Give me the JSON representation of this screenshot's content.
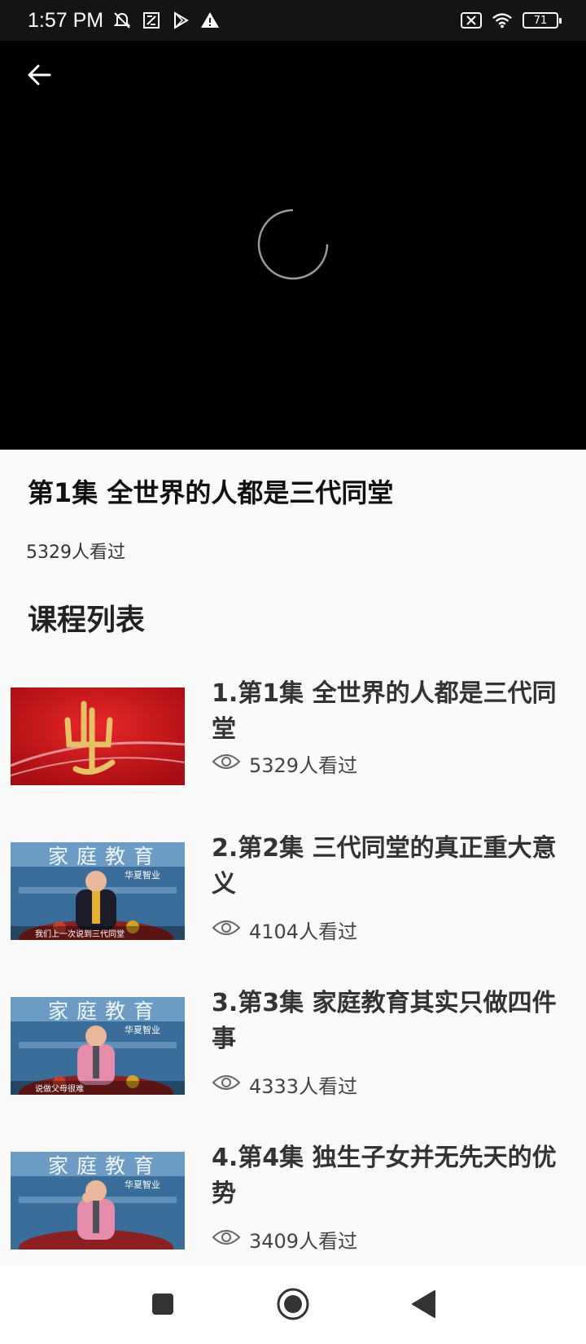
{
  "status_bar": {
    "time": "1:57 PM",
    "battery": "71",
    "icons": [
      "mute-icon",
      "notification-icon",
      "play-store-icon",
      "warning-icon",
      "sim-off-icon",
      "wifi-icon",
      "battery-icon"
    ]
  },
  "player": {
    "back_icon": "arrow-left-icon",
    "loading_icon": "spinner-icon"
  },
  "episode": {
    "title": "第1集  全世界的人都是三代同堂",
    "views": "5329人看过"
  },
  "course_list": {
    "heading": "课程列表",
    "items": [
      {
        "title": "1.第1集  全世界的人都是三代同堂",
        "views": "5329人看过"
      },
      {
        "title": "2.第2集 三代同堂的真正重大意义",
        "views": "4104人看过"
      },
      {
        "title": "3.第3集 家庭教育其实只做四件事",
        "views": "4333人看过"
      },
      {
        "title": "4.第4集 独生子女并无先天的优势",
        "views": "3409人看过"
      }
    ]
  },
  "thumbs": {
    "banner_text": "家庭教育",
    "subtitle_2": "我们上一次说到三代同堂",
    "subtitle_3": "说做父母很难",
    "logo_text": "华夏智业"
  },
  "nav_bar": {
    "icons": [
      "square-recent-icon",
      "circle-home-icon",
      "triangle-back-icon"
    ]
  },
  "colors": {
    "accent": "#000000",
    "background": "#fafafa",
    "thumb_red": "#c4141a",
    "thumb_blue": "#3a6d9a"
  }
}
